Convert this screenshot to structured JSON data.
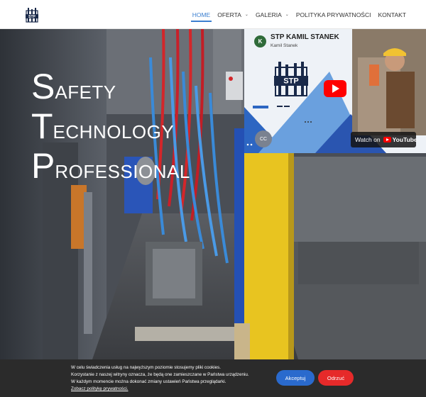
{
  "header": {
    "logo_text": "STP",
    "nav": [
      {
        "label": "HOME",
        "active": true,
        "has_dropdown": false
      },
      {
        "label": "OFERTA",
        "active": false,
        "has_dropdown": true
      },
      {
        "label": "GALERIA",
        "active": false,
        "has_dropdown": true
      },
      {
        "label": "POLITYKA PRYWATNOŚCI",
        "active": false,
        "has_dropdown": false
      },
      {
        "label": "KONTAKT",
        "active": false,
        "has_dropdown": false
      }
    ]
  },
  "hero": {
    "lines": [
      {
        "initial": "S",
        "rest": "AFETY"
      },
      {
        "initial": "T",
        "rest": "ECHNOLOGY"
      },
      {
        "initial": "P",
        "rest": "ROFESSIONAL"
      }
    ]
  },
  "video": {
    "channel_initial": "K",
    "title": "STP KAMIL STANEK",
    "channel_name": "Kamil Stanek",
    "thumbnail_logo_text": "STP",
    "watch_label": "Watch on",
    "youtube_label": "YouTube",
    "cc_label": "CC"
  },
  "cookie": {
    "lines": [
      "W celu świadczenia usług na najwyższym poziomie stosujemy pliki cookies.",
      "Korzystanie z naszej witryny oznacza, że będą one zamieszczane w Państwa urządzeniu.",
      "W każdym momencie można dokonać zmiany ustawień Państwa przeglądarki."
    ],
    "policy_link": "Zobacz politykę prywatności.",
    "accept_label": "Akceptuj",
    "reject_label": "Odrzuć"
  },
  "colors": {
    "accent": "#3b7fd0",
    "accept": "#2a6acd",
    "reject": "#e62a2a",
    "youtube": "#ff0000"
  }
}
